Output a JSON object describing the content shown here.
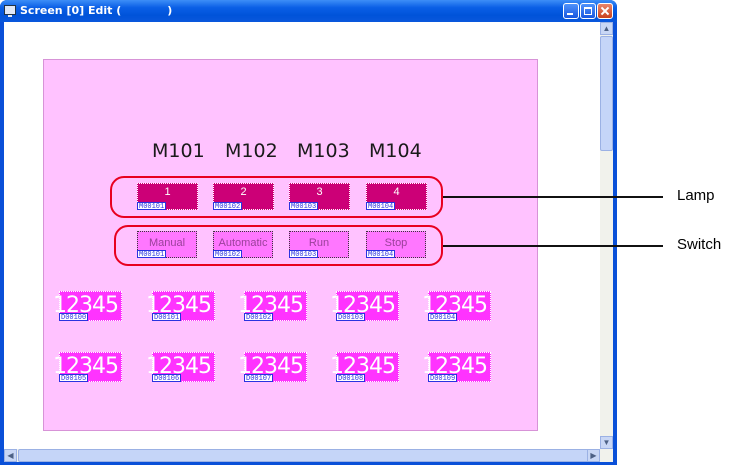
{
  "window": {
    "title": "Screen [0] Edit (            )"
  },
  "columns": [
    "M101",
    "M102",
    "M103",
    "M104"
  ],
  "lamps": [
    {
      "label": "1",
      "tag": "M00101"
    },
    {
      "label": "2",
      "tag": "M00102"
    },
    {
      "label": "3",
      "tag": "M00103"
    },
    {
      "label": "4",
      "tag": "M00104"
    }
  ],
  "switches": [
    {
      "label": "Manual",
      "tag": "M00101"
    },
    {
      "label": "Automatic",
      "tag": "M00102"
    },
    {
      "label": "Run",
      "tag": "M00103"
    },
    {
      "label": "Stop",
      "tag": "M00104"
    }
  ],
  "numeric_row1": [
    {
      "value": "12345",
      "tag": "D00100"
    },
    {
      "value": "12345",
      "tag": "D00101"
    },
    {
      "value": "12345",
      "tag": "D00102"
    },
    {
      "value": "12345",
      "tag": "D00103"
    },
    {
      "value": "12345",
      "tag": "D00104"
    }
  ],
  "numeric_row2": [
    {
      "value": "12345",
      "tag": "D00105"
    },
    {
      "value": "12345",
      "tag": "D00106"
    },
    {
      "value": "12345",
      "tag": "D00107"
    },
    {
      "value": "12345",
      "tag": "D00108"
    },
    {
      "value": "12345",
      "tag": "D00109"
    }
  ],
  "callouts": {
    "lamp": "Lamp",
    "switch": "Switch"
  },
  "colors": {
    "canvas": "#ffc2ff",
    "lamp": "#cc0077",
    "switch": "#ff77ff",
    "numeric": "#ff33ff",
    "oval": "#e8001f",
    "titlebar": "#0a5fe6"
  },
  "icons": {
    "window": "monitor-icon",
    "minimize": "minimize-icon",
    "maximize": "maximize-icon",
    "close": "close-icon"
  }
}
